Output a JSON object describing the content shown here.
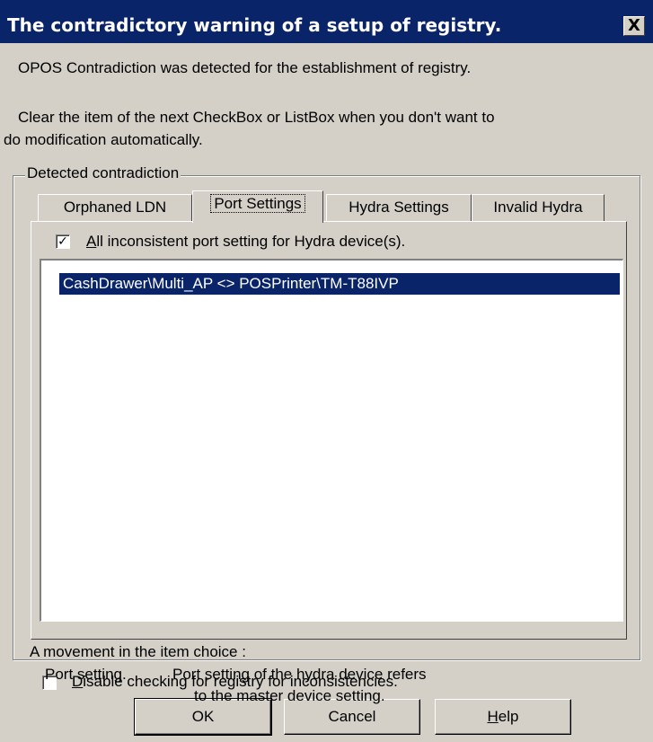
{
  "window": {
    "title": "The contradictory warning of a setup of registry.",
    "close_glyph": "X"
  },
  "intro": {
    "line1": "OPOS Contradiction was detected for the establishment of registry.",
    "line2": "Clear the item of the next CheckBox or ListBox when you don't want to",
    "line3": "do modification automatically."
  },
  "group": {
    "label": "Detected contradiction"
  },
  "tabs": [
    {
      "label": "Orphaned LDN"
    },
    {
      "label": "Port Settings"
    },
    {
      "label": "Hydra Settings"
    },
    {
      "label": "Invalid Hydra"
    }
  ],
  "active_tab": "Port Settings",
  "port_settings": {
    "checkbox_checked": true,
    "checkbox_mark": "✓",
    "checkbox_label_accel": "A",
    "checkbox_label_rest": "ll inconsistent port setting for Hydra device(s).",
    "list_items": [
      {
        "text": "CashDrawer\\Multi_AP <> POSPrinter\\TM-T88IVP",
        "selected": true
      }
    ]
  },
  "movement": {
    "heading": "A movement in the item choice :",
    "item_name": "Port setting.",
    "desc_line1": "Port setting of the hydra device refers",
    "desc_line2": "to the master device setting."
  },
  "disable_check": {
    "checked": false,
    "label_accel": "D",
    "label_rest": "isable checking for registry for inconsistencies."
  },
  "buttons": {
    "ok": "OK",
    "cancel": "Cancel",
    "help_accel": "H",
    "help_rest": "elp"
  },
  "colors": {
    "face": "#d4d0c8",
    "titlebar": "#0a246a",
    "selection": "#0a246a"
  }
}
